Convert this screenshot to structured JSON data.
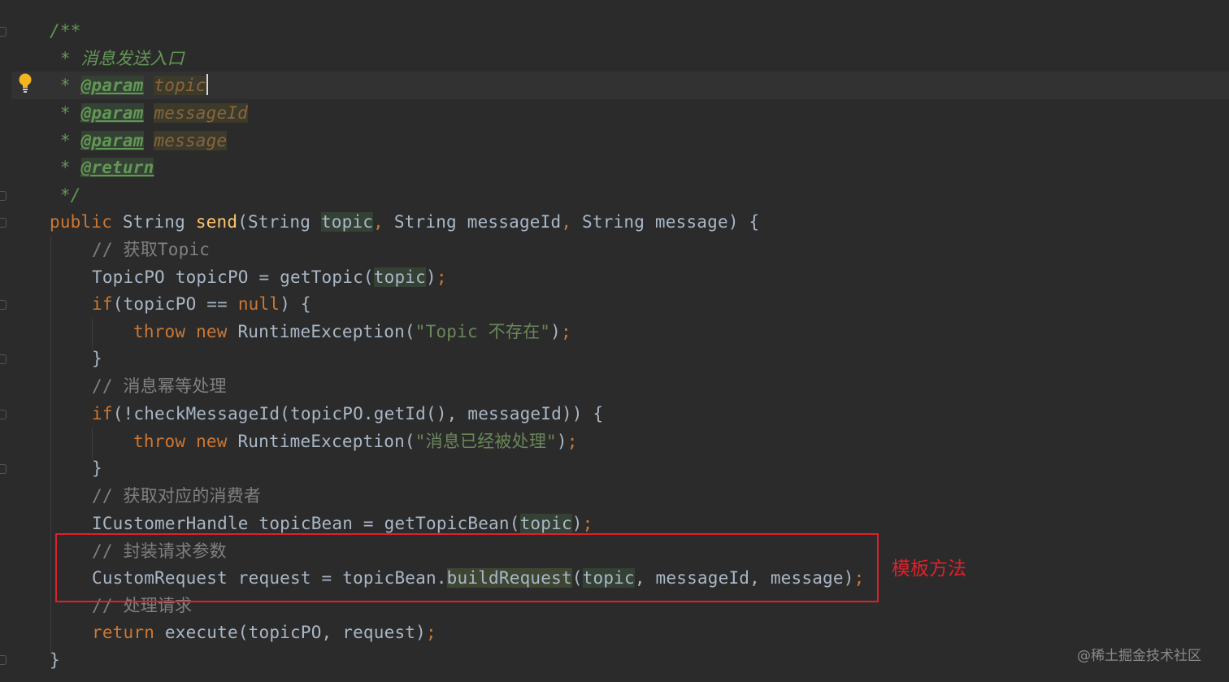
{
  "lines": [
    {
      "t": "/**"
    },
    {
      "t": " * 消息发送入口"
    },
    {
      "star": " * ",
      "tag": "@param",
      "val": "topic"
    },
    {
      "star": " * ",
      "tag": "@param",
      "val": "messageId"
    },
    {
      "star": " * ",
      "tag": "@param",
      "val": "message"
    },
    {
      "star": " * ",
      "tag": "@return"
    },
    {
      "t": " */"
    },
    {
      "kw": "public",
      "ret": "String",
      "fn": "send",
      "p1t": "String",
      "p1": "topic",
      "p2": "String messageId",
      "p3": "String message",
      "tail": ") {"
    },
    {
      "t": "// 获取Topic"
    },
    {
      "a": "TopicPO topicPO = getTopic(",
      "b": "topic",
      "c": ")",
      "d": ";"
    },
    {
      "kw": "if",
      "a": "(topicPO == ",
      "nul": "null",
      "b": ") {"
    },
    {
      "kw1": "throw",
      "kw2": "new",
      "a": "RuntimeException(",
      "s": "\"Topic 不存在\"",
      "b": ")",
      "d": ";"
    },
    {
      "t": "}"
    },
    {
      "t": "// 消息幂等处理"
    },
    {
      "kw": "if",
      "a": "(!checkMessageId(topicPO.getId(), messageId)) {"
    },
    {
      "kw1": "throw",
      "kw2": "new",
      "a": "RuntimeException(",
      "s": "\"消息已经被处理\"",
      "b": ")",
      "d": ";"
    },
    {
      "t": "}"
    },
    {
      "t": "// 获取对应的消费者"
    },
    {
      "a": "ICustomerHandle topicBean = getTopicBean(",
      "b": "topic",
      "c": ")",
      "d": ";"
    },
    {
      "t": "// 封装请求参数"
    },
    {
      "a": "CustomRequest request = topicBean.",
      "m": "buildRequest",
      "b": "(",
      "p": "topic",
      "c": ", messageId, message)",
      "d": ";"
    },
    {
      "t": "// 处理请求"
    },
    {
      "kw": "return",
      "a": " execute(topicPO, request)",
      "d": ";"
    },
    {
      "t": "}"
    }
  ],
  "annotation": "模板方法",
  "watermark": "@稀土掘金技术社区",
  "colors": {
    "keyword": "#cc7832",
    "function": "#ffc66d",
    "comment": "#808080",
    "string": "#6a8759",
    "doc": "#629755",
    "highlight_box": "#e0202a"
  }
}
